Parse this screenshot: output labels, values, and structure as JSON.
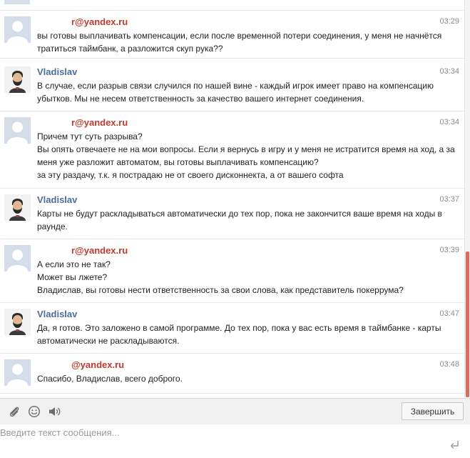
{
  "messages": [
    {
      "author": "r@yandex.ru",
      "kind": "user",
      "time": "03:29",
      "lines": [
        "вы готовы выплачивать компенсации, если после временной потери соединения, у меня не начнётся",
        "тратиться таймбанк, а разложится скуп рука??"
      ]
    },
    {
      "author": "Vladislav",
      "kind": "staff",
      "time": "03:34",
      "lines": [
        "В случае, если разрыв связи случился по нашей вине - каждый игрок имеет право на компенсацию",
        "убытков. Мы не несем ответственность за качество вашего интернет соединения."
      ]
    },
    {
      "author": "r@yandex.ru",
      "kind": "user",
      "time": "03:34",
      "lines": [
        "Причем тут суть разрыва?",
        "Вы опять отвечаете не на мои вопросы. Если я вернусь в игру и у меня не истратится время на ход, а за",
        "меня уже разложит автоматом, вы готовы выплачивать компенсацию?",
        "за эту раздачу, т.к. я пострадаю не от своего дисконнекта, а от вашего софта"
      ]
    },
    {
      "author": "Vladislav",
      "kind": "staff",
      "time": "03:37",
      "lines": [
        "Карты не будут раскладываться автоматически до тех пор, пока не закончится ваше время на ходы в",
        "раунде."
      ]
    },
    {
      "author": "r@yandex.ru",
      "kind": "user",
      "time": "03:39",
      "lines": [
        "А если это не так?",
        "Может вы лжете?",
        "Владислав, вы готовы нести ответственность за свои слова, как представитель покеррума?"
      ]
    },
    {
      "author": "Vladislav",
      "kind": "staff",
      "time": "03:47",
      "lines": [
        "Да, я готов. Это заложено в самой программе. До тех пор, пока у вас есть время в таймбанке - карты",
        "автоматически не раскладываются."
      ]
    },
    {
      "author": "@yandex.ru",
      "kind": "user",
      "time": "03:48",
      "lines": [
        "Спасибо, Владислав, всего доброго."
      ]
    }
  ],
  "toolbar": {
    "attach_icon": "paperclip-icon",
    "emoji_icon": "smiley-icon",
    "sound_icon": "speaker-icon",
    "finish_label": "Завершить"
  },
  "input": {
    "placeholder": "Введите текст сообщения...",
    "value": ""
  },
  "colors": {
    "user_name": "#c0392b",
    "staff_name": "#4a6f9c",
    "scroll_thumb": "#e2685c"
  }
}
